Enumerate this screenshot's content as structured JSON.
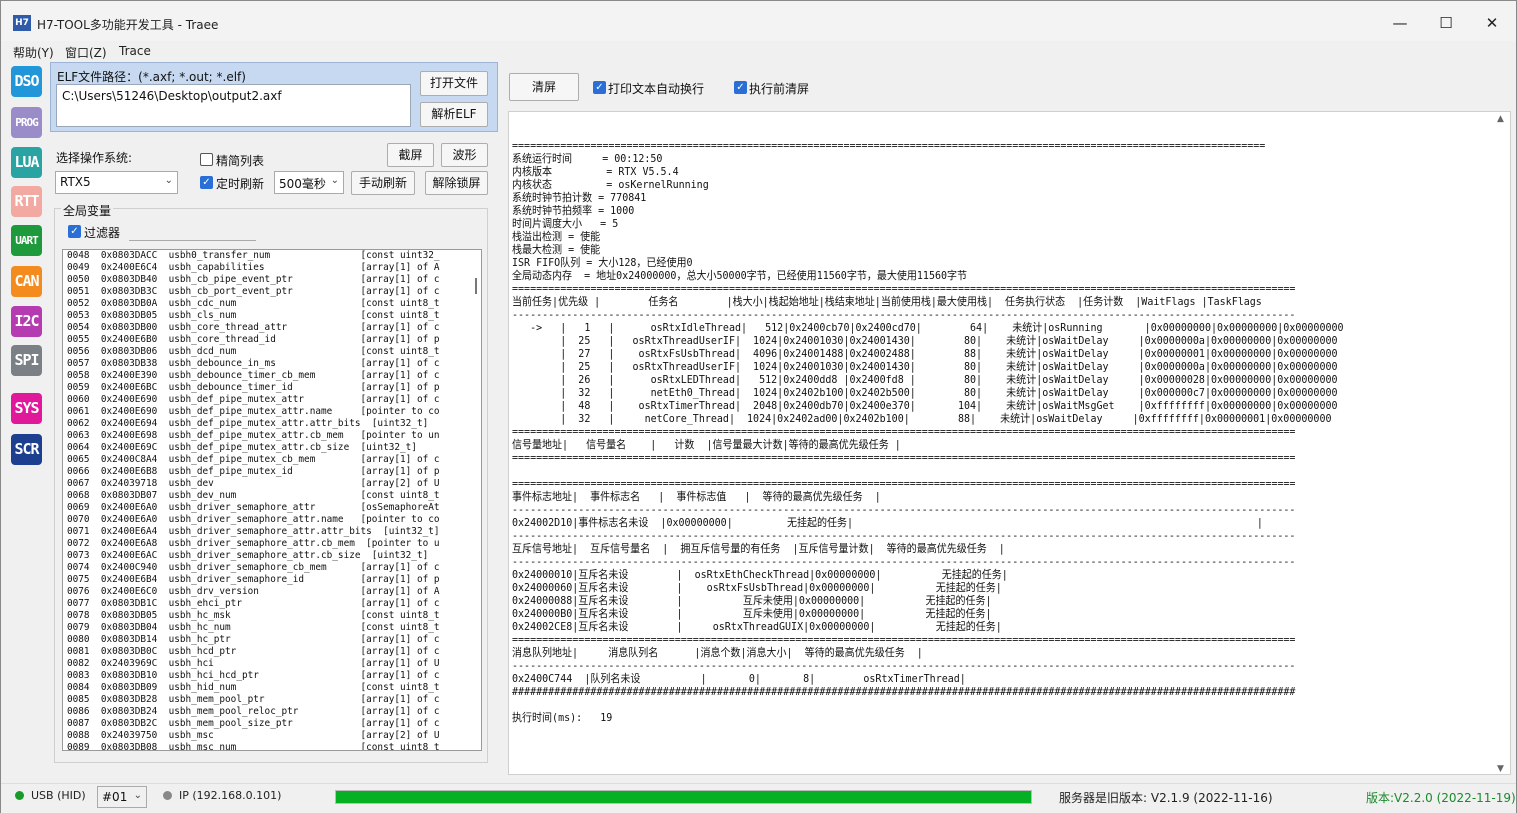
{
  "window": {
    "icon_text": "H7",
    "title": "H7-TOOL多功能开发工具 - Traee",
    "minimize": "—",
    "maximize": "☐",
    "close": "✕"
  },
  "menu": [
    "帮助(Y)",
    "窗口(Z)",
    "Trace"
  ],
  "tools": [
    {
      "label": "DSO",
      "color": "#2196d8"
    },
    {
      "label": "PROG",
      "color": "#9a8cc8"
    },
    {
      "label": "LUA",
      "color": "#2aa3a3"
    },
    {
      "label": "RTT",
      "color": "#f2a9a2"
    },
    {
      "label": "UART",
      "color": "#1e9a3c"
    },
    {
      "label": "CAN",
      "color": "#f38b1e"
    },
    {
      "label": "I2C",
      "color": "#b53bb0"
    },
    {
      "label": "SPI",
      "color": "#7b7f86"
    },
    {
      "label": "SYS",
      "color": "#e0189a"
    },
    {
      "label": "SCR",
      "color": "#1d3f8f"
    }
  ],
  "elf": {
    "label": "ELF文件路径：(*.axf; *.out; *.elf)",
    "path": "C:\\Users\\51246\\Desktop\\output2.axf",
    "open_button": "打开文件",
    "parse_button": "解析ELF"
  },
  "os": {
    "label": "选择操作系统:",
    "selected": "RTX5",
    "compact_list_label": "精简列表",
    "compact_list_checked": false,
    "timer_refresh_label": "定时刷新",
    "timer_refresh_checked": true,
    "interval_selected": "500毫秒",
    "screenshot_button": "截屏",
    "waveform_button": "波形",
    "manual_refresh_button": "手动刷新",
    "unlock_button": "解除锁屏"
  },
  "globals": {
    "title": "全局变量",
    "filter_label": "过滤器",
    "filter_checked": true,
    "filter_value": "",
    "rows": [
      "0048  0x0803DACC  usbh0_transfer_num                [const uint32_",
      "0049  0x2400E6C4  usbh_capabilities                 [array[1] of A",
      "0050  0x0803DB40  usbh_cb_pipe_event_ptr            [array[1] of c",
      "0051  0x0803DB3C  usbh_cb_port_event_ptr            [array[1] of c",
      "0052  0x0803DB0A  usbh_cdc_num                      [const uint8_t",
      "0053  0x0803DB05  usbh_cls_num                      [const uint8_t",
      "0054  0x0803DB00  usbh_core_thread_attr             [array[1] of c",
      "0055  0x2400E6B0  usbh_core_thread_id               [array[1] of p",
      "0056  0x0803DB06  usbh_dcd_num                      [const uint8_t",
      "0057  0x0803DB38  usbh_debounce_in_ms               [array[1] of c",
      "0058  0x2400E390  usbh_debounce_timer_cb_mem        [array[1] of c",
      "0059  0x2400E6BC  usbh_debounce_timer_id            [array[1] of p",
      "0060  0x2400E690  usbh_def_pipe_mutex_attr          [array[1] of c",
      "0061  0x2400E690  usbh_def_pipe_mutex_attr.name     [pointer to co",
      "0062  0x2400E694  usbh_def_pipe_mutex_attr.attr_bits  [uint32_t]",
      "0063  0x2400E698  usbh_def_pipe_mutex_attr.cb_mem   [pointer to un",
      "0064  0x2400E69C  usbh_def_pipe_mutex_attr.cb_size  [uint32_t]",
      "0065  0x2400C8A4  usbh_def_pipe_mutex_cb_mem        [array[1] of c",
      "0066  0x2400E6B8  usbh_def_pipe_mutex_id            [array[1] of p",
      "0067  0x24039718  usbh_dev                          [array[2] of U",
      "0068  0x0803DB07  usbh_dev_num                      [const uint8_t",
      "0069  0x2400E6A0  usbh_driver_semaphore_attr        [osSemaphoreAt",
      "0070  0x2400E6A0  usbh_driver_semaphore_attr.name   [pointer to co",
      "0071  0x2400E6A4  usbh_driver_semaphore_attr.attr_bits  [uint32_t]",
      "0072  0x2400E6A8  usbh_driver_semaphore_attr.cb_mem  [pointer to u",
      "0073  0x2400E6AC  usbh_driver_semaphore_attr.cb_size  [uint32_t]",
      "0074  0x2400C940  usbh_driver_semaphore_cb_mem      [array[1] of c",
      "0075  0x2400E6B4  usbh_driver_semaphore_id          [array[1] of p",
      "0076  0x2400E6C0  usbh_drv_version                  [array[1] of A",
      "0077  0x0803DB1C  usbh_ehci_ptr                     [array[1] of c",
      "0078  0x0803DB05  usbh_hc_msk                       [const uint8_t",
      "0079  0x0803DB04  usbh_hc_num                       [const uint8_t",
      "0080  0x0803DB14  usbh_hc_ptr                       [array[1] of c",
      "0081  0x0803DB0C  usbh_hcd_ptr                      [array[1] of c",
      "0082  0x2403969C  usbh_hci                          [array[1] of U",
      "0083  0x0803DB10  usbh_hci_hcd_ptr                  [array[1] of c",
      "0084  0x0803DB09  usbh_hid_num                      [const uint8_t",
      "0085  0x0803DB28  usbh_mem_pool_ptr                 [array[1] of c",
      "0086  0x0803DB24  usbh_mem_pool_reloc_ptr           [array[1] of c",
      "0087  0x0803DB2C  usbh_mem_pool_size_ptr            [array[1] of c",
      "0088  0x24039750  usbh_msc                          [array[2] of U",
      "0089  0x0803DB08  usbh_msc_num                      [const uint8_t"
    ]
  },
  "output_controls": {
    "clear_button": "清屏",
    "auto_wrap_label": "打印文本自动换行",
    "auto_wrap_checked": true,
    "clear_before_label": "执行前清屏",
    "clear_before_checked": true
  },
  "output_lines": [
    "=============================================================================================================================",
    "系统运行时间     = 00:12:50",
    "内核版本         = RTX V5.5.4",
    "内核状态         = osKernelRunning",
    "系统时钟节拍计数 = 770841",
    "系统时钟节拍频率 = 1000",
    "时间片调度大小   = 5",
    "栈溢出检测 = 使能",
    "栈最大检测 = 使能",
    "ISR FIFO队列 = 大小128，已经使用0",
    "全局动态内存  = 地址0x24000000，总大小50000字节，已经使用11560字节，最大使用11560字节",
    "==================================================================================================================================",
    "当前任务|优先级 |        任务名        |栈大小|栈起始地址|栈结束地址|当前使用栈|最大使用栈|  任务执行状态  |任务计数  |WaitFlags |TaskFlags ",
    "----------------------------------------------------------------------------------------------------------------------------------",
    "   ->   |   1   |      osRtxIdleThread|   512|0x2400cb70|0x2400cd70|        64|    未统计|osRunning       |0x00000000|0x00000000|0x00000000",
    "        |  25   |   osRtxThreadUserIF|  1024|0x24001030|0x24001430|        80|    未统计|osWaitDelay     |0x0000000a|0x00000000|0x00000000",
    "        |  27   |    osRtxFsUsbThread|  4096|0x24001488|0x24002488|        88|    未统计|osWaitDelay     |0x00000001|0x00000000|0x00000000",
    "        |  25   |   osRtxThreadUserIF|  1024|0x24001030|0x24001430|        80|    未统计|osWaitDelay     |0x0000000a|0x00000000|0x00000000",
    "        |  26   |      osRtxLEDThread|   512|0x2400dd8 |0x2400fd8 |        80|    未统计|osWaitDelay     |0x00000028|0x00000000|0x00000000",
    "        |  32   |      netEth0_Thread|  1024|0x2402b100|0x2402b500|        80|    未统计|osWaitDelay     |0x000000c7|0x00000000|0x00000000",
    "        |  48   |    osRtxTimerThread|  2048|0x2400db70|0x2400e370|       104|    未统计|osWaitMsgGet    |0xffffffff|0x00000000|0x00000000",
    "        |  32   |     netCore_Thread|  1024|0x2402ad00|0x2402b100|        88|    未统计|osWaitDelay     |0xffffffff|0x00000001|0x00000000",
    "==================================================================================================================================",
    "信号量地址|   信号量名    |   计数  |信号量最大计数|等待的最高优先级任务 |",
    "==================================================================================================================================",
    "",
    "==================================================================================================================================",
    "事件标志地址|  事件标志名   |  事件标志值   |  等待的最高优先级任务  |",
    "----------------------------------------------------------------------------------------------------------------------------------",
    "0x24002D10|事件标志名未设  |0x00000000|         无挂起的任务|                                                                   |",
    "----------------------------------------------------------------------------------------------------------------------------------",
    "互斥信号地址|  互斥信号量名  |  拥互斥信号量的有任务  |互斥信号量计数|  等待的最高优先级任务  |",
    "----------------------------------------------------------------------------------------------------------------------------------",
    "0x24000010|互斥名未设        |  osRtxEthCheckThread|0x00000000|          无挂起的任务|",
    "0x24000060|互斥名未设        |    osRtxFsUsbThread|0x00000000|          无挂起的任务|",
    "0x24000088|互斥名未设        |          互斥未使用|0x00000000|          无挂起的任务|",
    "0x240000B0|互斥名未设        |          互斥未使用|0x00000000|          无挂起的任务|",
    "0x24002CE8|互斥名未设        |     osRtxThreadGUIX|0x00000000|          无挂起的任务|",
    "==================================================================================================================================",
    "消息队列地址|     消息队列名      |消息个数|消息大小|  等待的最高优先级任务  |",
    "----------------------------------------------------------------------------------------------------------------------------------",
    "0x2400C744  |队列名未设          |       0|       8|        osRtxTimerThread|",
    "##################################################################################################################################",
    "",
    "执行时间(ms):   19"
  ],
  "status": {
    "usb_label": "USB (HID)",
    "device_selected": "#01",
    "ip_label": "IP (192.168.0.101)",
    "progress": 1.0,
    "server_text": "服务器是旧版本: V2.1.9 (2022-11-16)",
    "version_text": "版本:V2.2.0 (2022-11-19)",
    "usb_color": "#1a9a2a",
    "ip_color": "#888888",
    "progress_color": "#06b025",
    "version_color": "#1a8a2a"
  }
}
